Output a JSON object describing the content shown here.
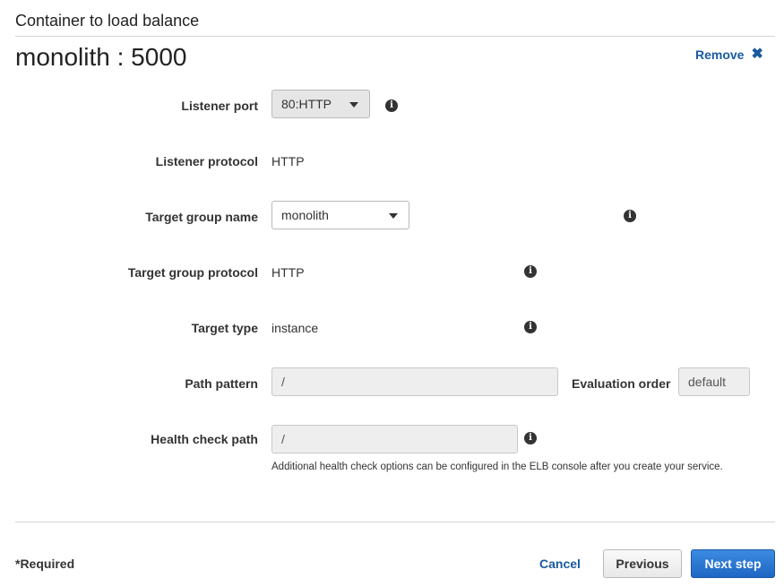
{
  "section_title": "Container to load balance",
  "heading": "monolith : 5000",
  "remove_label": "Remove",
  "remove_icon": "close-icon",
  "fields": {
    "listener_port": {
      "label": "Listener port",
      "value": "80:HTTP"
    },
    "listener_protocol": {
      "label": "Listener protocol",
      "value": "HTTP"
    },
    "target_group_name": {
      "label": "Target group name",
      "value": "monolith"
    },
    "target_group_protocol": {
      "label": "Target group protocol",
      "value": "HTTP"
    },
    "target_type": {
      "label": "Target type",
      "value": "instance"
    },
    "path_pattern": {
      "label": "Path pattern",
      "value": "/"
    },
    "evaluation_order": {
      "label": "Evaluation order",
      "value": "default"
    },
    "health_check_path": {
      "label": "Health check path",
      "value": "/"
    }
  },
  "info_glyph": "i",
  "helper_text": "Additional health check options can be configured in the ELB console after you create your service.",
  "footer": {
    "required": "*Required",
    "cancel": "Cancel",
    "previous": "Previous",
    "next": "Next step"
  },
  "colors": {
    "link": "#1a5aa0",
    "primary_button": "#2a72d1",
    "divider": "#d5d5d5"
  }
}
